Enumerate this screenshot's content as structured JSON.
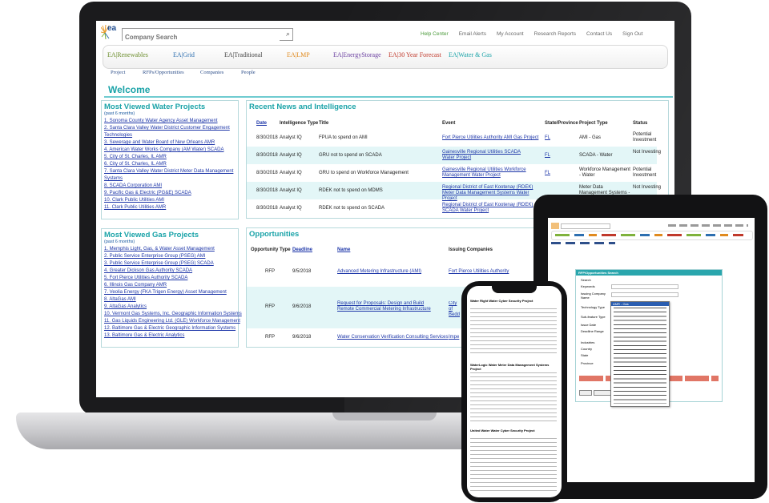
{
  "header": {
    "search_placeholder": "Company Search",
    "nav": [
      "Help Center",
      "Email Alerts",
      "My Account",
      "Research Reports",
      "Contact Us",
      "Sign Out"
    ]
  },
  "brands": [
    {
      "label": "EA|Renewables",
      "color": "#6a8c2a"
    },
    {
      "label": "EA|Grid",
      "color": "#2d6fb0"
    },
    {
      "label": "EA|Traditional",
      "color": "#444444"
    },
    {
      "label": "EA|LMP",
      "color": "#e08a1e"
    },
    {
      "label": "EA|EnergyStorage",
      "color": "#6a3fa0"
    },
    {
      "label": "EA|30 Year Forecast",
      "color": "#c0392b"
    },
    {
      "label": "EA|Water & Gas",
      "color": "#1aa3a8"
    }
  ],
  "subnav": [
    "Project",
    "RFPs/Opportunities",
    "Companies",
    "People"
  ],
  "welcome": "Welcome",
  "water_projects": {
    "title": "Most Viewed Water Projects",
    "subtitle": "(past 6 months)",
    "items": [
      "1. Sonoma County Water Agency Asset Management",
      "2. Santa Clara Valley Water District Customer Engagement Technologies",
      "3. Sewerage and Water Board of New Orleans AMR",
      "4. American Water Works Company (AM Water) SCADA",
      "5. City of St. Charles, IL AMR",
      "6. City of St. Charles, IL AMR",
      "7. Santa Clara Valley Water District Meter Data Management Systems",
      "8. SCADA Corporation AMI",
      "9. Pacific Gas & Electric (PG&E) SCADA",
      "10. Clark Public Utilities AMI",
      "11. Clark Public Utilities AMR"
    ]
  },
  "gas_projects": {
    "title": "Most Viewed Gas Projects",
    "subtitle": "(past 6 months)",
    "items": [
      "1. Memphis Light, Gas, & Water Asset Management",
      "2. Public Service Enterprise Group (PSEG) AMI",
      "3. Public Service Enterprise Group (PSEG) SCADA",
      "4. Greater Dickson Gas Authority SCADA",
      "5. Fort Pierce Utilities Authority SCADA",
      "6. Illinois Gas Company AMR",
      "7. Veolia Energy (FKA Trigen Energy) Asset Management",
      "8. AltaGas AMI",
      "9. AltaGas Analytics",
      "10. Vermont Gas Systems, Inc. Geographic Information Systems",
      "11. Gas Liquids Engineering Ltd. (GLE) Workforce Management",
      "12. Baltimore Gas & Electric Geographic Information Systems",
      "13. Baltimore Gas & Electric Analytics"
    ]
  },
  "news": {
    "title": "Recent News and Intelligence",
    "headers": [
      "Date",
      "Intelligence Type",
      "Title",
      "Event",
      "State/Province",
      "Project Type",
      "Status"
    ],
    "rows": [
      {
        "date": "8/30/2018",
        "type": "Analyst IQ",
        "title": "FPUA to spend on AMI",
        "event": "Fort Pierce Utilities Authority AMI Gas Project",
        "state": "FL",
        "ptype": "AMI - Gas",
        "status": "Potential Investment"
      },
      {
        "date": "8/30/2018",
        "type": "Analyst IQ",
        "title": "GRU not to spend on SCADA",
        "event": "Gainesville Regional Utilities SCADA Water Project",
        "state": "FL",
        "ptype": "SCADA - Water",
        "status": "Not Investing"
      },
      {
        "date": "8/30/2018",
        "type": "Analyst IQ",
        "title": "GRU to spend on Workforce Management",
        "event": "Gainesville Regional Utilities Workforce Management Water Project",
        "state": "FL",
        "ptype": "Workforce Management - Water",
        "status": "Potential Investment"
      },
      {
        "date": "8/30/2018",
        "type": "Analyst IQ",
        "title": "RDEK not to spend on MDMS",
        "event": "Regional District of East Kootenay (RDEK) Meter Data Management Systems Water Project",
        "state": "",
        "ptype": "Meter Data Management Systems - Water",
        "status": "Not Investing"
      },
      {
        "date": "8/30/2018",
        "type": "Analyst IQ",
        "title": "RDEK not to spend on SCADA",
        "event": "Regional District of East Kootenay (RDEK) SCADA Water Project",
        "state": "",
        "ptype": "",
        "status": ""
      }
    ]
  },
  "opportunities": {
    "title": "Opportunities",
    "headers": [
      "Opportunity Type",
      "Deadline",
      "Name",
      "Issuing Companies"
    ],
    "rows": [
      {
        "type": "RFP",
        "deadline": "9/5/2018",
        "name": "Advanced Metering Infrastructure (AMI)",
        "issuer": "Fort Pierce Utilities Authority"
      },
      {
        "type": "RFP",
        "deadline": "9/6/2018",
        "name": "Request for Proposals: Design and Build Remote Commercial Metering Infrastructure",
        "issuer": "City of Bedd"
      },
      {
        "type": "RFP",
        "deadline": "9/6/2018",
        "name": "Water Conservation Verification Consulting Services",
        "issuer": "Impe"
      }
    ]
  },
  "tablet": {
    "panel_title": "RFP/Opportunities Search",
    "labels": [
      "Search",
      "Keywords",
      "Issuing Company Name",
      "Technology Type",
      "Sub-feature Type",
      "Issue Date",
      "Deadline Range",
      "Industries",
      "Country",
      "State",
      "Province"
    ],
    "dropdown_selected": "AMR - Gas",
    "dropdown_options": [
      "Communications Network - Gas",
      "Communications Network - Water",
      "Customer Engagement Technologies - Gas",
      "Customer Engagement Technologies - Water",
      "Customer Information/Billing System - Gas",
      "Customer Information/Billing System - Water",
      "Cyber Security - Gas",
      "Cyber Security - Water",
      "Demand Response - Gas",
      "Demand Response - Water",
      "Geographic Information Systems - Gas",
      "Geographic Information Systems - Water",
      "IoT - Gas",
      "IoT - Water",
      "Meter Data Management Systems - Gas",
      "Meter Data Management Systems - Water",
      "Metering Non-Revenue Water - Water",
      "SCADA - Gas",
      "SCADA - Water",
      "Smart Meter",
      "Smart Water",
      "Workforce Management - Gas",
      "Workforce Management - Water"
    ],
    "buttons": [
      "Search",
      "Clear All Fields"
    ]
  },
  "phone": {
    "sections": [
      "Water Right Water Cyber Security Project",
      "WaterLogic Water Meter Data Management Systems Project",
      "United Water Water Cyber Security Project"
    ]
  }
}
